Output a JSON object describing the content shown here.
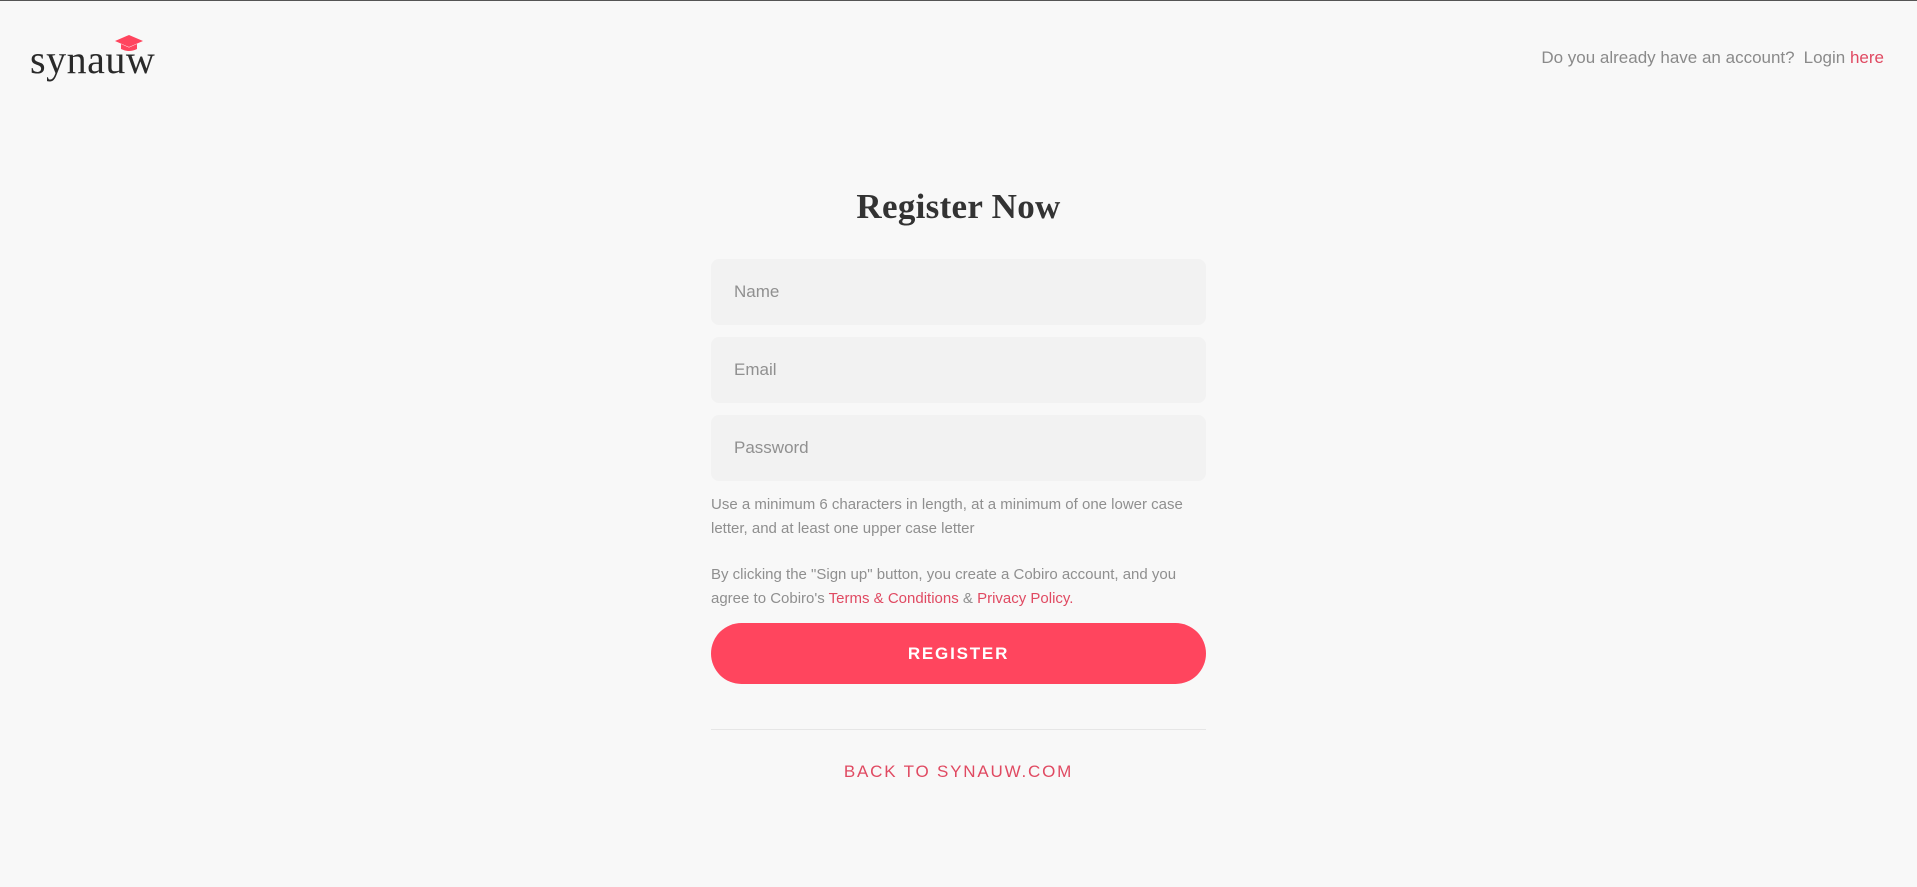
{
  "header": {
    "logo_text": "synauw",
    "logo_icon": "graduation-cap-icon",
    "login_prompt": "Do you already have an account?",
    "login_word": "Login",
    "login_link": "here"
  },
  "main": {
    "title": "Register Now",
    "fields": {
      "name_placeholder": "Name",
      "email_placeholder": "Email",
      "password_placeholder": "Password"
    },
    "password_hint": "Use a minimum 6 characters in length, at a minimum of one lower case letter, and at least one upper case letter",
    "terms": {
      "prefix": "By clicking the \"Sign up\" button, you create a Cobiro account, and you agree to Cobiro's ",
      "terms_link": "Terms & Conditions",
      "separator": " & ",
      "privacy_link": "Privacy Policy."
    },
    "register_button": "REGISTER",
    "back_link": "BACK TO SYNAUW.COM"
  },
  "colors": {
    "accent": "#ff455e",
    "link": "#e04a62",
    "background": "#f8f8f8",
    "field_background": "#f2f2f2"
  }
}
